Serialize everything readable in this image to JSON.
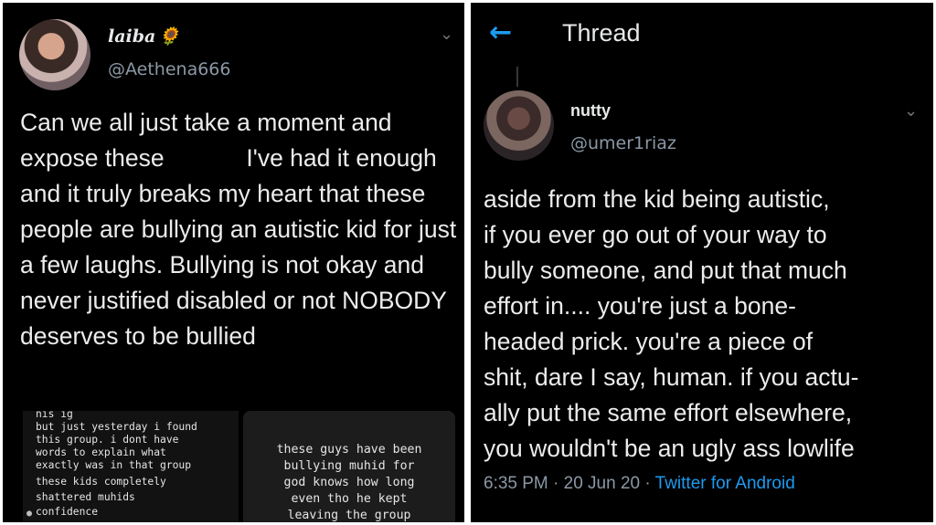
{
  "left_tweet": {
    "display_name": "laiba",
    "display_name_emoji": "🌻",
    "handle": "@Aethena666",
    "text_part1": "Can we all just take a moment and expose these",
    "text_part2": "I've had it enough and it truly breaks my heart that these people are bullying an autistic kid for just a few laughs. Bullying is not okay and never justified disabled or not NOBODY deserves to be bullied",
    "attached_screenshots": [
      {
        "lines": [
          "nis ig",
          "but just yesterday i found",
          "this group. i dont have",
          "words to explain what",
          "exactly was in that group",
          "these kids completely",
          "shattered muhids",
          "confidence"
        ]
      },
      {
        "text": "these guys have been\nbullying muhid for\ngod knows how long\neven tho he kept\nleaving the group"
      }
    ]
  },
  "right_tweet": {
    "header_title": "Thread",
    "display_name": "nutty",
    "handle": "@umer1riaz",
    "text": "aside from the kid being autistic,\nif you ever go out of your way to\nbully someone, and put that much\neffort in.... you're just a bone-\nheaded prick. you're a piece of\nshit, dare I say, human. if you actu-\nally put the same effort elsewhere,\nyou wouldn't be an ugly ass lowlife",
    "time": "6:35 PM · 20 Jun 20 · ",
    "source": "Twitter for Android"
  },
  "icons": {
    "back": "back-arrow-icon",
    "more": "chevron-down-icon",
    "user": "user-icon"
  },
  "colors": {
    "background": "#000000",
    "accent": "#1d9bf0",
    "secondary_text": "#8b98a5"
  }
}
